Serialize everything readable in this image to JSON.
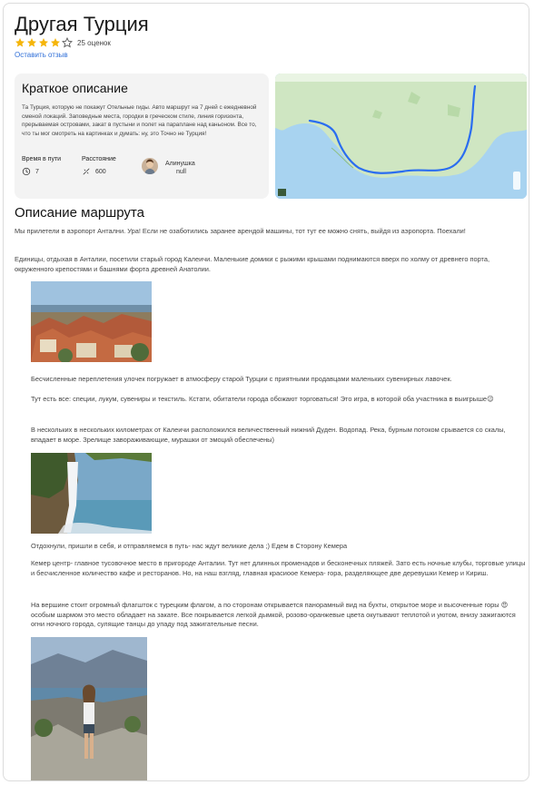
{
  "page": {
    "title": "Другая Турция",
    "rating_count": "25 оценок",
    "rating_value": 4,
    "rating_max": 5,
    "review_link": "Оставить отзыв"
  },
  "summary": {
    "heading": "Краткое описание",
    "text": "Та Турция, которую не покажут Отельные гиды. Авто маршрут на 7 дней с ежедневной сменой локаций. Заповедные места, городки в греческом стиле, линия горизонта, прерываемая островами, закат в пустыни и полет на параплане над каньоном. Все то, что ты мог смотреть на картинках и думать: ну, это Точно не Турция!",
    "time_label": "Время в пути",
    "time_value": "7",
    "distance_label": "Расстояние",
    "distance_value": "600",
    "author_name": "Алинушка",
    "author_sub": "null"
  },
  "route": {
    "heading": "Описание маршрута",
    "p1": "Мы прилетели в аэропорт Антални. Ура! Если не озаботились заранее арендой машины, тот тут ее можно снять, выйдя из аэропорта. Поехали!",
    "p2": "Единицы, отдыхая в Анталии, посетили старый город Калеичи. Маленькие домики с рыжими крышами поднимаются вверх по холму от древнего порта, окруженного крепостями и башнями форта древней Анатолии.",
    "p3": "Бесчисленные переплетения улочек погружает в атмосферу старой Турции с приятными продавцами маленьких сувенирных лавочек.",
    "p4": "Тут есть все: специи, лукум,  сувениры и текстиль. Кстати, обитатели города обожают торговаться! Это игра, в которой оба участника в выигрыше😉",
    "p5": "В нескольких в нескольких километрах от Калеичи расположился величественный нижний Дуден. Водопад. Река, бурным потоком срывается со скалы, впадает в море. Зрелище завораживающие, мурашки от эмоций обеспечены)",
    "p6": "Отдохнули, пришли в себя, и отправляемся в путь- нас ждут великие дела ;) Едем в Сторону Кемера",
    "p7": "Кемер центр- главное тусовочное место в пригороде Анталии. Тут нет длинных променадов и бесконечных пляжей. Зато есть ночные клубы, торговые улицы и бесчисленное количество кафе и ресторанов. Но, на наш взгляд, главная красиоое Кемера- гора, разделяющее две деревушки Кемер и Кириш.",
    "p8": "На вершине стоит огромный флагшток с турецким флагом, а по сторонам открывается панорамный вид на бухты, открытое море и высоченные горы 😍 особым шармом это место обладает на закате. Все покрывается легкой дымкой, розово-оранжевые цвета окутывают теплотой и уютом, внизу зажигаются огни ночного города, сулящие танцы до упаду под зажигательные песни."
  },
  "colors": {
    "star": "#f5b50a",
    "link": "#2f6fd8",
    "card_bg": "#f3f3f3",
    "map_water": "#a8d3f0",
    "map_land": "#cfe6c2",
    "route": "#2a6df0"
  }
}
